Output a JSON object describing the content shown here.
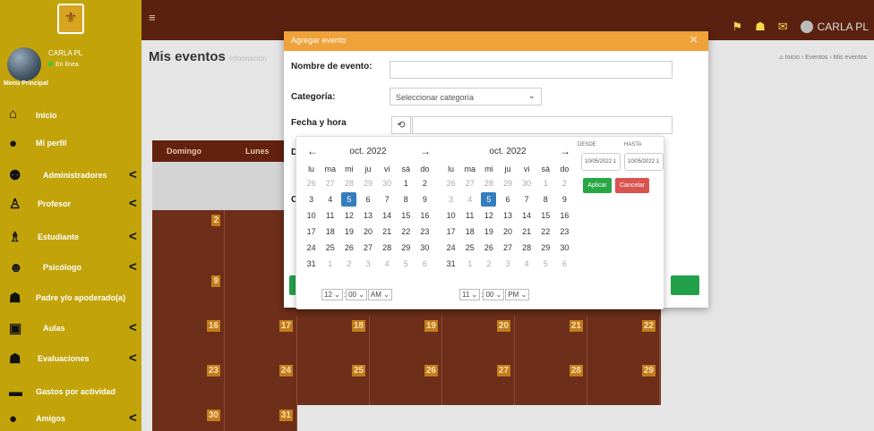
{
  "navbar": {
    "user_name": "CARLA PL"
  },
  "sidebar": {
    "user": {
      "name": "CARLA PL",
      "status": "En línea"
    },
    "menu_title": "Menú Principal",
    "items": [
      {
        "label": "Inicio"
      },
      {
        "label": "Mi perfil"
      },
      {
        "label": "Administradores"
      },
      {
        "label": "Profesor"
      },
      {
        "label": "Estudiante"
      },
      {
        "label": "Psicólogo"
      },
      {
        "label": "Padre y/o apoderado(a)"
      },
      {
        "label": "Aulas"
      },
      {
        "label": "Evaluaciones"
      },
      {
        "label": "Gastos por actividad"
      },
      {
        "label": "Amigos"
      }
    ]
  },
  "header": {
    "title": "Mis eventos",
    "subtitle": "Información"
  },
  "breadcrumb": {
    "home": "Inicio",
    "eventos": "Eventos",
    "current": "Mis eventos"
  },
  "calendar": {
    "days": [
      "Domingo",
      "Lunes"
    ],
    "rows": [
      [
        "2",
        ""
      ],
      [
        "9",
        ""
      ],
      [
        "16",
        "17",
        "18",
        "19",
        "20",
        "21",
        "22"
      ],
      [
        "23",
        "24",
        "25",
        "26",
        "27",
        "28",
        "29"
      ],
      [
        "30",
        "31"
      ]
    ]
  },
  "modal": {
    "title": "Agregar evento",
    "close": "×",
    "name_label": "Nombre de evento:",
    "category_label": "Categoría:",
    "category_placeholder": "Seleccionar categoría",
    "datetime_label": "Fecha y hora",
    "desc_label_letter": "D",
    "color_label_letter": "C"
  },
  "datepicker": {
    "month": "oct. 2022",
    "weekdays": [
      "lu",
      "ma",
      "mi",
      "ju",
      "vi",
      "sá",
      "do"
    ],
    "left_time": {
      "hour": "12",
      "minute": "00",
      "ampm": "AM"
    },
    "right_time": {
      "hour": "11",
      "minute": "00",
      "ampm": "PM"
    },
    "from_label": "DESDE",
    "to_label": "HASTA",
    "from_value": "10/05/2022 1",
    "to_value": "10/05/2022 1",
    "apply": "Aplicar",
    "cancel": "Cancelar"
  },
  "colors": {
    "navbar": "#5a2110",
    "sidebar": "#c2a40a",
    "modal_header": "#f0a23a",
    "calendar": "#62220f",
    "selected_day": "#357ebd",
    "apply": "#28a745",
    "cancel": "#d9534f"
  }
}
